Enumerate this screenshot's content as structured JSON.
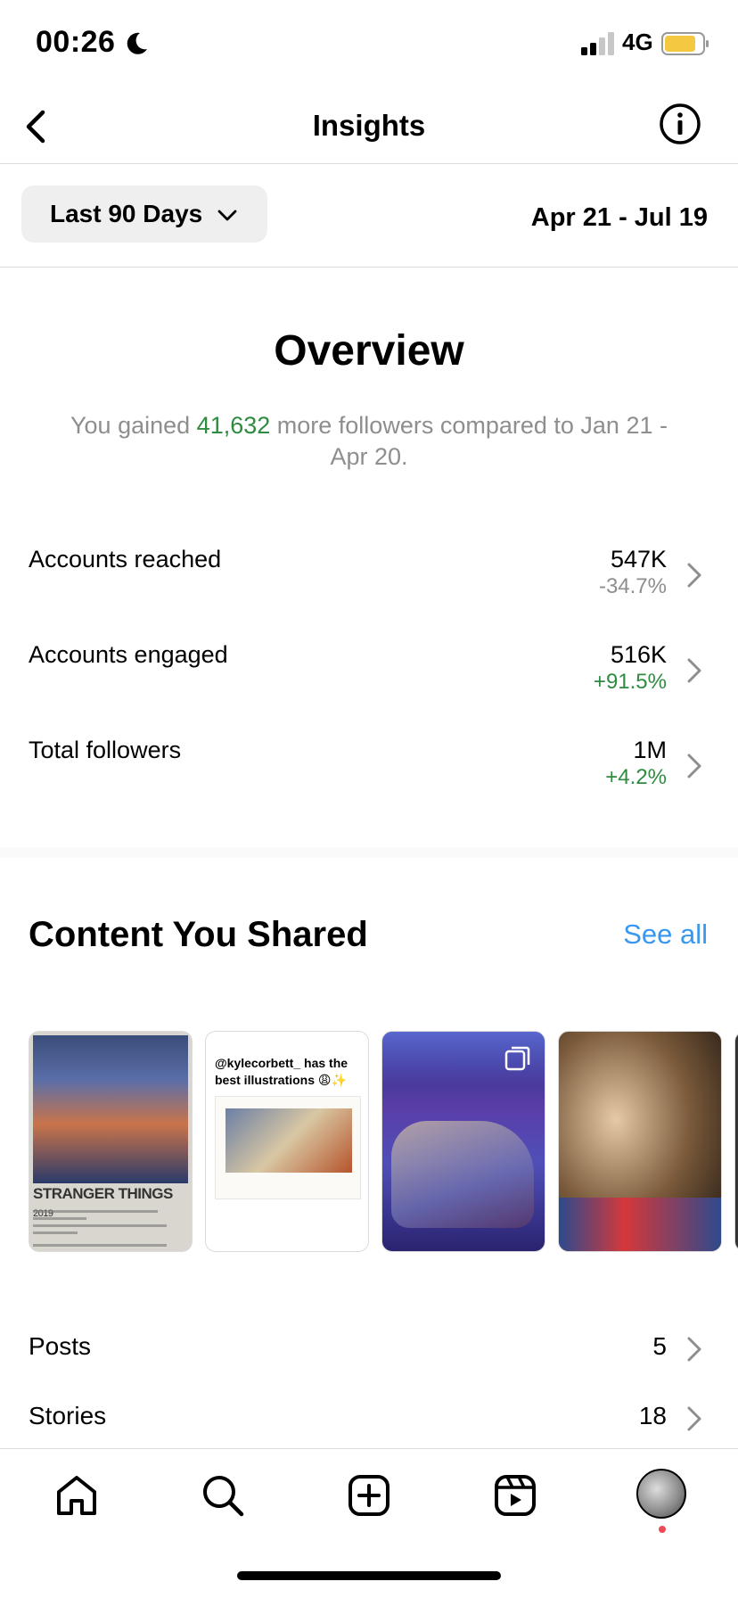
{
  "status_bar": {
    "time": "00:26",
    "network": "4G",
    "icons": [
      "moon-icon",
      "signal-icon",
      "battery-icon"
    ],
    "battery_color": "#f5c842"
  },
  "nav": {
    "title": "Insights",
    "back_icon": "back-arrow-icon",
    "info_icon": "info-icon"
  },
  "filter": {
    "range_label": "Last 90 Days",
    "date_range": "Apr 21 - Jul 19"
  },
  "overview": {
    "title": "Overview",
    "desc_prefix": "You gained ",
    "desc_highlight": "41,632",
    "desc_suffix": " more followers compared to Jan 21 - Apr 20.",
    "metrics": [
      {
        "label": "Accounts reached",
        "value": "547K",
        "change": "-34.7%"
      },
      {
        "label": "Accounts engaged",
        "value": "516K",
        "change": "+91.5%"
      },
      {
        "label": "Total followers",
        "value": "1M",
        "change": "+4.2%"
      }
    ]
  },
  "content": {
    "title": "Content You Shared",
    "see_all": "See all",
    "thumbnails": [
      {
        "poster_title": "STRANGER THINGS",
        "poster_year": "2019"
      },
      {
        "caption": "@kylecorbett_ has the best illustrations 😩✨"
      },
      {
        "icon": "multiple-posts-icon"
      },
      {},
      {}
    ],
    "rows": [
      {
        "label": "Posts",
        "value": "5"
      },
      {
        "label": "Stories",
        "value": "18"
      }
    ]
  },
  "tab_bar": {
    "tabs": [
      "home-icon",
      "search-icon",
      "create-icon",
      "reels-icon",
      "profile-avatar"
    ]
  },
  "colors": {
    "positive": "#2e8b3f",
    "muted": "#8e8e8e",
    "link": "#3897f0",
    "notification": "#ed4956"
  }
}
